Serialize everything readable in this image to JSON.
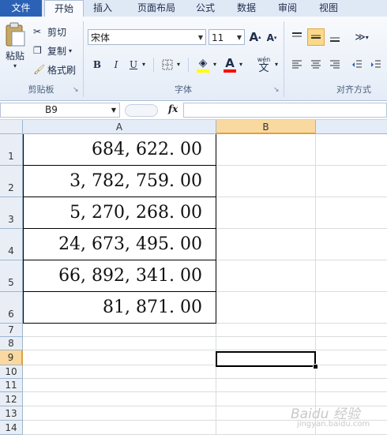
{
  "tabs": [
    "文件",
    "开始",
    "插入",
    "页面布局",
    "公式",
    "数据",
    "审阅",
    "视图"
  ],
  "clipboard": {
    "paste": "粘贴",
    "cut": "剪切",
    "copy": "复制",
    "format_painter": "格式刷",
    "group": "剪贴板"
  },
  "font": {
    "name": "宋体",
    "size": "11",
    "bold": "B",
    "italic": "I",
    "underline": "U",
    "grow": "A",
    "shrink": "A",
    "color_a": "A",
    "wen": "wén",
    "wen_char": "文",
    "group": "字体",
    "fill_color": "#ffff00",
    "font_color": "#ff0000"
  },
  "alignment": {
    "group": "对齐方式"
  },
  "formula_bar": {
    "name_box": "B9",
    "fx": "fx",
    "content": ""
  },
  "columns": [
    "A",
    "B"
  ],
  "rows": [
    "1",
    "2",
    "3",
    "4",
    "5",
    "6",
    "7",
    "8",
    "9",
    "10",
    "11",
    "12",
    "13",
    "14"
  ],
  "cells": {
    "A1": "684, 622. 00",
    "A2": "3, 782, 759. 00",
    "A3": "5, 270, 268. 00",
    "A4": "24, 673, 495. 00",
    "A5": "66, 892, 341. 00",
    "A6": "81, 871. 00"
  },
  "active_cell": "B9",
  "watermark": "Baidu 经验",
  "watermark_sub": "jingyan.baidu.com"
}
